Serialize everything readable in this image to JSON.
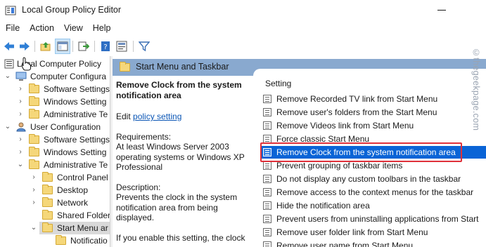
{
  "window": {
    "title": "Local Group Policy Editor"
  },
  "menu": [
    "File",
    "Action",
    "View",
    "Help"
  ],
  "toolbar": {
    "icons": [
      "back-arrow-icon",
      "forward-arrow-icon",
      "up-folder-icon",
      "show-hide-tree-icon",
      "export-list-icon",
      "help-icon",
      "properties-icon",
      "filter-icon"
    ]
  },
  "tree": {
    "root": "Local Computer Policy",
    "computer_config": "Computer Configura",
    "cc_software": "Software Settings",
    "cc_windows": "Windows Setting",
    "cc_admin": "Administrative Te",
    "user_config": "User Configuration",
    "uc_software": "Software Settings",
    "uc_windows": "Windows Setting",
    "uc_admin": "Administrative Te",
    "control_panel": "Control Panel",
    "desktop": "Desktop",
    "network": "Network",
    "shared_folders": "Shared Folder",
    "start_menu": "Start Menu ar",
    "notifications": "Notificatio"
  },
  "pane": {
    "header_title": "Start Menu and Taskbar",
    "desc_title": "Remove Clock from the system notification area",
    "edit_prefix": "Edit ",
    "edit_link": "policy setting",
    "requirements_label": "Requirements:",
    "requirements_text": "At least Windows Server 2003 operating systems or Windows XP Professional",
    "description_label": "Description:",
    "description_text": "Prevents the clock in the system notification area from being displayed.",
    "more_text": "If you enable this setting, the clock"
  },
  "list": {
    "column": "Setting",
    "items": [
      "Remove Recorded TV link from Start Menu",
      "Remove user's folders from the Start Menu",
      "Remove Videos link from Start Menu",
      "Force classic Start Menu",
      "Remove Clock from the system notification area",
      "Prevent grouping of taskbar items",
      "Do not display any custom toolbars in the taskbar",
      "Remove access to the context menus for the taskbar",
      "Hide the notification area",
      "Prevent users from uninstalling applications from Start",
      "Remove user folder link from Start Menu",
      "Remove user name from Start Menu"
    ],
    "selected_index": 4
  },
  "watermark": "©thegeekpage.com",
  "colors": {
    "selection": "#0a64d6",
    "header_band": "#89a9cf",
    "highlight": "#e0313a",
    "link": "#0b56b5"
  }
}
